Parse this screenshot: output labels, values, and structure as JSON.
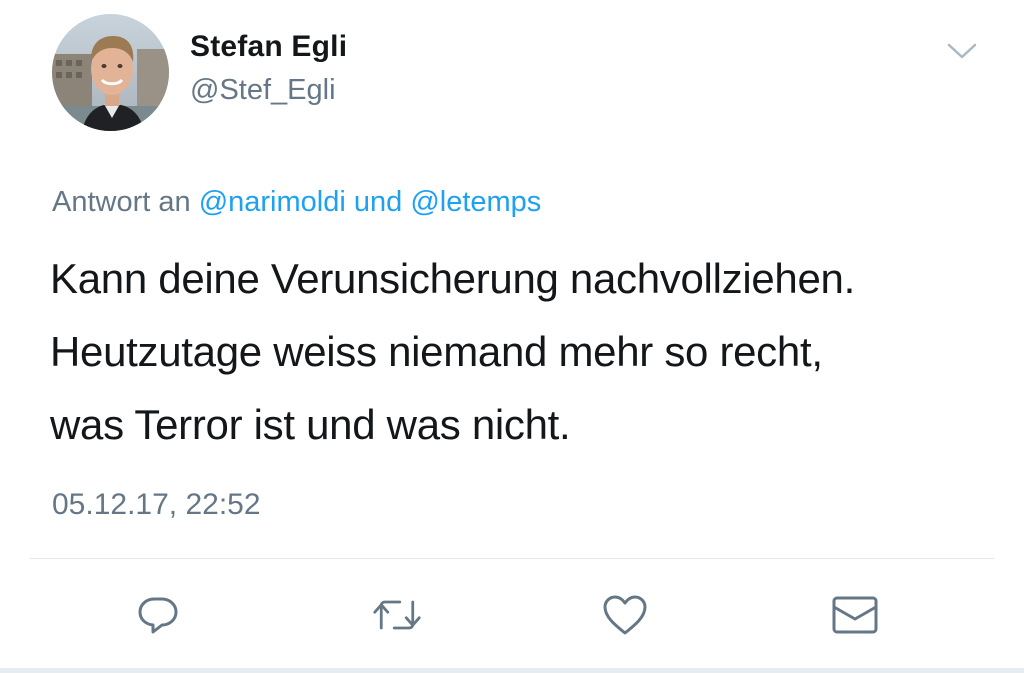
{
  "author": {
    "display_name": "Stefan Egli",
    "handle": "@Stef_Egli"
  },
  "reply": {
    "prefix": "Antwort an",
    "mention_1": "@narimoldi",
    "conjunction": "und",
    "mention_2": "@letemps"
  },
  "tweet": {
    "lines": [
      "Kann deine Verunsicherung nachvollziehen.",
      "Heutzutage weiss niemand mehr so recht,",
      "was Terror ist und was nicht."
    ],
    "timestamp": "05.12.17, 22:52"
  },
  "actions": [
    {
      "icon": "reply-icon"
    },
    {
      "icon": "retweet-icon"
    },
    {
      "icon": "like-icon"
    },
    {
      "icon": "message-icon"
    }
  ],
  "colors": {
    "text": "#14171a",
    "secondary": "#657786",
    "mention": "#1da1f2",
    "icon": "#657786",
    "divider": "#e1e8ed"
  }
}
